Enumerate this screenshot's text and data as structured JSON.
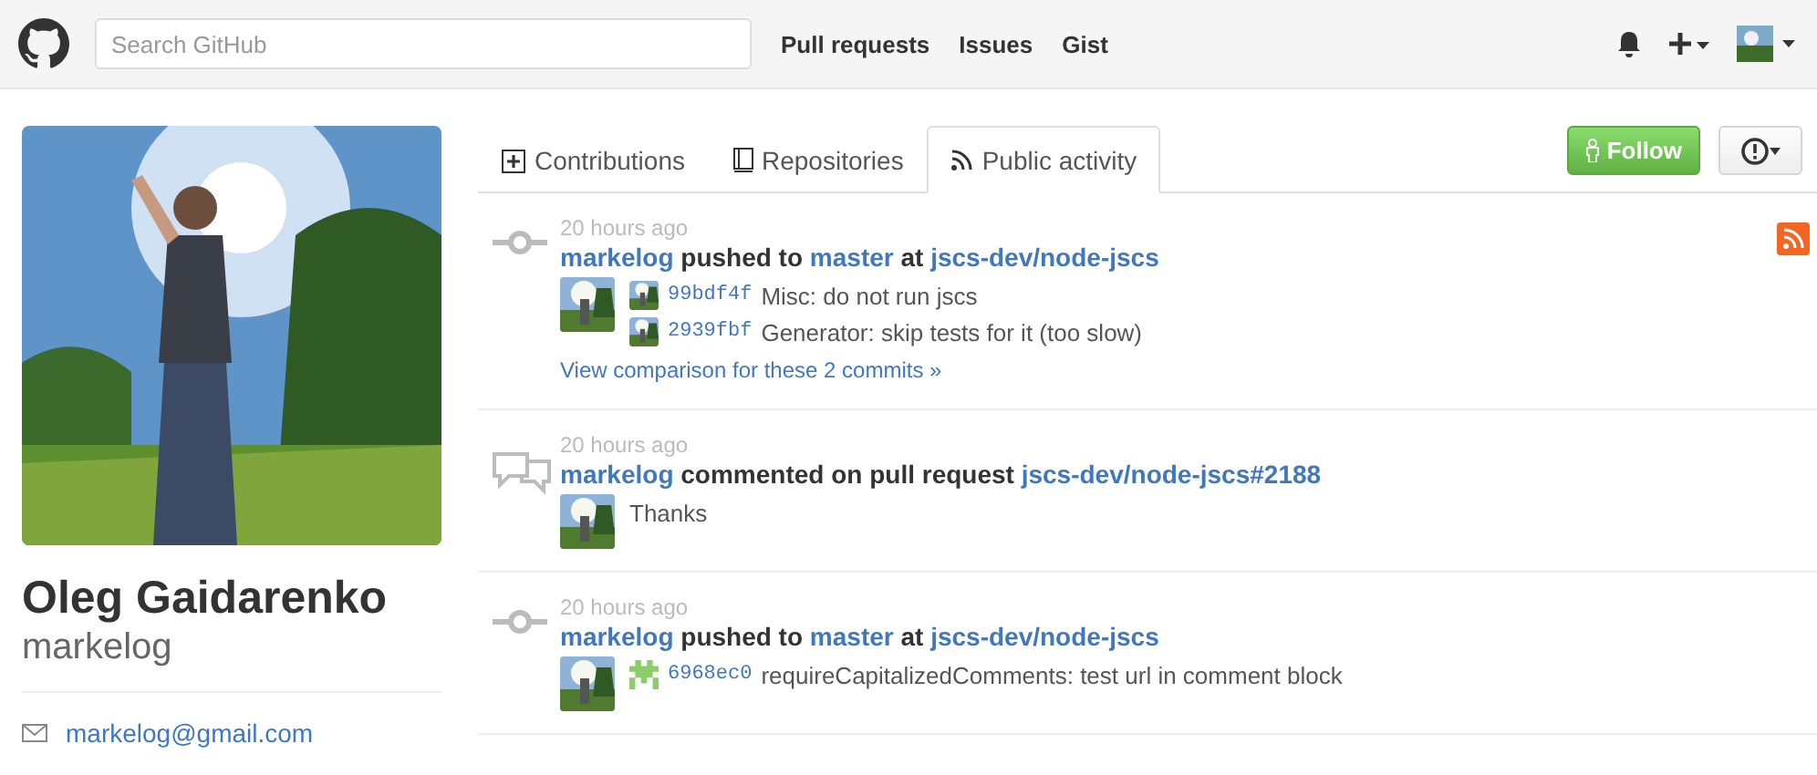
{
  "header": {
    "search": {
      "placeholder": "Search GitHub"
    },
    "nav": [
      "Pull requests",
      "Issues",
      "Gist"
    ]
  },
  "profile": {
    "name": "Oleg Gaidarenko",
    "username": "markelog",
    "email": "markelog@gmail.com"
  },
  "tabs": [
    {
      "label": "Contributions",
      "kind": "plus",
      "selected": false
    },
    {
      "label": "Repositories",
      "kind": "book",
      "selected": false
    },
    {
      "label": "Public activity",
      "kind": "rss",
      "selected": true
    }
  ],
  "follow": "Follow",
  "events": [
    {
      "kind": "push",
      "time": "20 hours ago",
      "actor": "markelog",
      "action": "pushed to",
      "branch": "master",
      "preposition": "at",
      "repo": "jscs-dev/node-jscs",
      "commits": [
        {
          "sha": "99bdf4f",
          "message": "Misc: do not run jscs"
        },
        {
          "sha": "2939fbf",
          "message": "Generator: skip tests for it (too slow)"
        }
      ],
      "compare": "View comparison for these 2 commits »"
    },
    {
      "kind": "comment",
      "time": "20 hours ago",
      "actor": "markelog",
      "action": "commented on pull request",
      "repo": "jscs-dev/node-jscs#2188",
      "comment": "Thanks"
    },
    {
      "kind": "push",
      "time": "20 hours ago",
      "actor": "markelog",
      "action": "pushed to",
      "branch": "master",
      "preposition": "at",
      "repo": "jscs-dev/node-jscs",
      "commits": [
        {
          "kind": "identicon",
          "sha": "6968ec0",
          "message": "requireCapitalizedComments: test url in comment block"
        }
      ]
    }
  ]
}
